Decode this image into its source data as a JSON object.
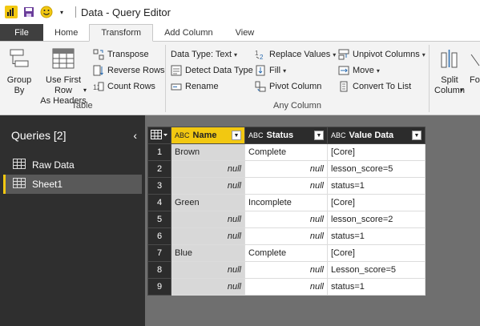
{
  "window": {
    "title": "Data - Query Editor"
  },
  "ribbon_tabs": [
    "File",
    "Home",
    "Transform",
    "Add Column",
    "View"
  ],
  "ribbon": {
    "table_group": {
      "group_by": "Group\nBy",
      "use_first_row": "Use First Row\nAs Headers",
      "transpose": "Transpose",
      "reverse_rows": "Reverse Rows",
      "count_rows": "Count Rows",
      "label": "Table"
    },
    "any_column_group": {
      "data_type": "Data Type: Text",
      "detect_data_type": "Detect Data Type",
      "rename": "Rename",
      "replace_values": "Replace Values",
      "fill": "Fill",
      "pivot_column": "Pivot Column",
      "unpivot_columns": "Unpivot Columns",
      "move": "Move",
      "convert_to_list": "Convert To List",
      "label": "Any Column"
    },
    "text_group": {
      "split_column": "Split\nColumn",
      "format_partial": "Fo"
    }
  },
  "queries": {
    "header": "Queries [2]",
    "items": [
      {
        "label": "Raw Data"
      },
      {
        "label": "Sheet1"
      }
    ]
  },
  "grid": {
    "abc_label": "ABC",
    "columns": [
      "Name",
      "Status",
      "Value Data"
    ],
    "rows": [
      {
        "n": "1",
        "name": "Brown",
        "status": "Complete",
        "value": "[Core]"
      },
      {
        "n": "2",
        "name": "null",
        "status": "null",
        "value": "lesson_score=5"
      },
      {
        "n": "3",
        "name": "null",
        "status": "null",
        "value": "status=1"
      },
      {
        "n": "4",
        "name": "Green",
        "status": "Incomplete",
        "value": "[Core]"
      },
      {
        "n": "5",
        "name": "null",
        "status": "null",
        "value": "lesson_score=2"
      },
      {
        "n": "6",
        "name": "null",
        "status": "null",
        "value": "status=1"
      },
      {
        "n": "7",
        "name": "Blue",
        "status": "Complete",
        "value": "[Core]"
      },
      {
        "n": "8",
        "name": "null",
        "status": "null",
        "value": "Lesson_score=5"
      },
      {
        "n": "9",
        "name": "null",
        "status": "null",
        "value": "status=1"
      }
    ]
  },
  "colors": {
    "accent": "#f2c811",
    "pane_bg": "#2f2f2f",
    "data_bg": "#6f6f6f"
  }
}
